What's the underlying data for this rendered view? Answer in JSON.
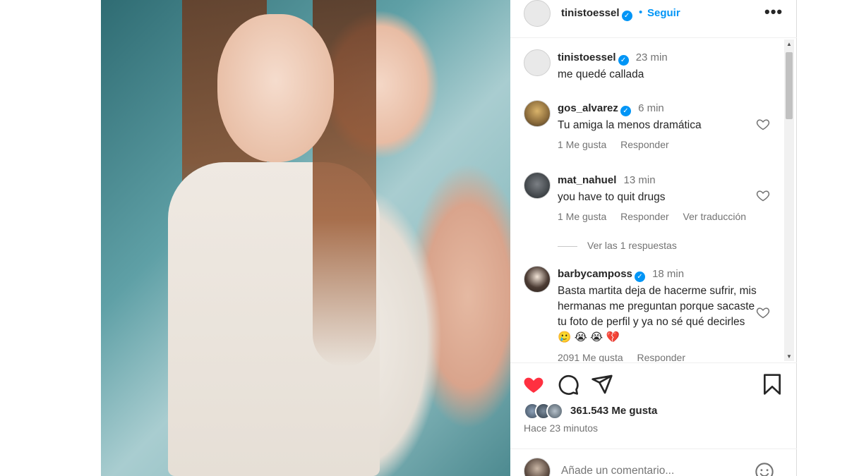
{
  "header": {
    "username": "tinistoessel",
    "follow_label": "Seguir",
    "dot": "•"
  },
  "caption": {
    "username": "tinistoessel",
    "time": "23 min",
    "text": "me quedé callada"
  },
  "comments": [
    {
      "username": "gos_alvarez",
      "verified": true,
      "time": "6 min",
      "text": "Tu amiga la menos dramática",
      "likes": "1 Me gusta",
      "reply": "Responder"
    },
    {
      "username": "mat_nahuel",
      "verified": false,
      "time": "13 min",
      "text": "you have to quit drugs",
      "likes": "1 Me gusta",
      "reply": "Responder",
      "translate": "Ver traducción",
      "replies": "Ver las 1 respuestas"
    },
    {
      "username": "barbycamposs",
      "verified": true,
      "time": "18 min",
      "text": "Basta martita deja de hacerme sufrir, mis hermanas me preguntan porque sacaste tu foto de perfil y ya no sé qué decirles 🥲 😭 😭 💔",
      "likes": "2091 Me gusta",
      "reply": "Responder"
    }
  ],
  "post": {
    "liked": true,
    "likes_count": "361.543 Me gusta",
    "posted_ago": "Hace 23 minutos"
  },
  "composer": {
    "placeholder": "Añade un comentario..."
  },
  "colors": {
    "accent": "#0095f6",
    "like_red": "#ff3040",
    "text_primary": "#262626",
    "text_secondary": "#737373"
  },
  "icons": [
    "more-options-icon",
    "heart-icon",
    "comment-icon",
    "share-icon",
    "bookmark-icon",
    "emoji-icon",
    "verified-badge-icon"
  ]
}
